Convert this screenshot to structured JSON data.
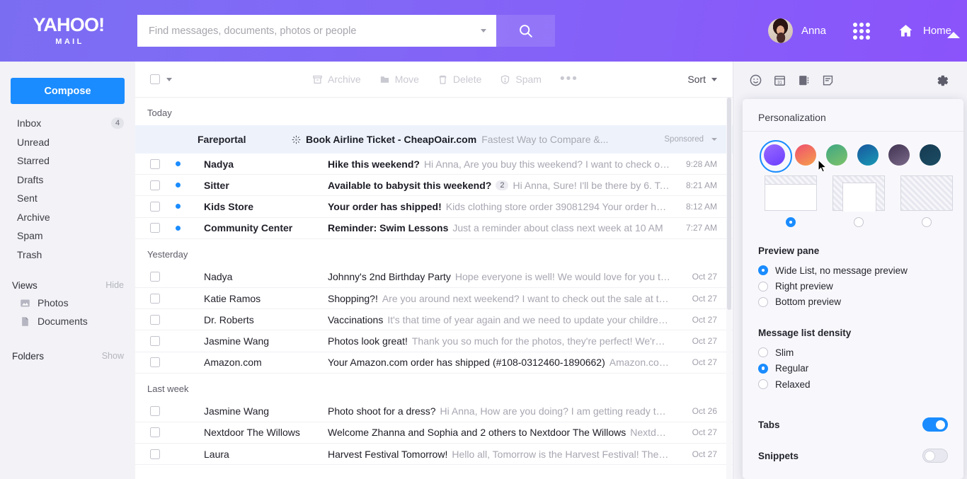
{
  "header": {
    "logo_main": "YAHOO!",
    "logo_sub": "MAIL",
    "search_placeholder": "Find messages, documents, photos or people",
    "search_value": "",
    "search_icon": "search-icon",
    "dropdown_icon": "chevron-down-icon",
    "user_name": "Anna",
    "apps_icon": "apps-grid-icon",
    "home_icon": "home-icon",
    "home_label": "Home",
    "gradient_from": "#7b6df2",
    "gradient_to": "#8b53fb"
  },
  "sidebar": {
    "compose_label": "Compose",
    "compose_color": "#1a8cff",
    "folders": [
      {
        "label": "Inbox",
        "count": "4"
      },
      {
        "label": "Unread",
        "count": ""
      },
      {
        "label": "Starred",
        "count": ""
      },
      {
        "label": "Drafts",
        "count": ""
      },
      {
        "label": "Sent",
        "count": ""
      },
      {
        "label": "Archive",
        "count": ""
      },
      {
        "label": "Spam",
        "count": ""
      },
      {
        "label": "Trash",
        "count": ""
      }
    ],
    "views_title": "Views",
    "views_toggle": "Hide",
    "views": [
      {
        "label": "Photos",
        "icon": "photo-icon"
      },
      {
        "label": "Documents",
        "icon": "document-icon"
      }
    ],
    "folders_title": "Folders",
    "folders_toggle": "Show"
  },
  "toolbar": {
    "select_all_icon": "checkbox-icon",
    "select_all_chevron": "chevron-down-icon",
    "archive_label": "Archive",
    "move_label": "Move",
    "delete_label": "Delete",
    "spam_label": "Spam",
    "more_label": "•••",
    "sort_label": "Sort"
  },
  "maillist": {
    "groups": [
      {
        "label": "Today",
        "ad": {
          "sender": "Fareportal",
          "title": "Book Airline Ticket - CheapOair.com",
          "description": "Fastest Way to Compare &...",
          "tag": "Sponsored",
          "icon": "sponsored-starburst-icon"
        },
        "rows": [
          {
            "sender": "Nadya",
            "unread": true,
            "subject": "Hike this weekend?",
            "snippet": "Hi Anna, Are you buy this weekend? I want to check out this",
            "time": "9:28 AM",
            "thread": ""
          },
          {
            "sender": "Sitter",
            "unread": true,
            "subject": "Available to babysit this weekend?",
            "snippet": "Hi Anna, Sure! I'll be there by 6. Take care, Sara",
            "time": "8:21 AM",
            "thread": "2"
          },
          {
            "sender": "Kids Store",
            "unread": true,
            "subject": "Your order has shipped!",
            "snippet": "Kids clothing store order 39081294 Your order has shipped and",
            "time": "8:12 AM",
            "thread": ""
          },
          {
            "sender": "Community Center",
            "unread": true,
            "subject": "Reminder: Swim Lessons",
            "snippet": "Just a reminder about class next week at 10 AM",
            "time": "7:27 AM",
            "thread": ""
          }
        ]
      },
      {
        "label": "Yesterday",
        "rows": [
          {
            "sender": "Nadya",
            "unread": false,
            "subject": "Johnny's 2nd Birthday Party",
            "snippet": "Hope everyone is well! We would love for you to join",
            "time": "Oct 27",
            "thread": ""
          },
          {
            "sender": "Katie Ramos",
            "unread": false,
            "subject": "Shopping?!",
            "snippet": "Are you around next weekend? I want to check out the sale at this new boutique",
            "time": "Oct 27",
            "thread": ""
          },
          {
            "sender": "Dr. Roberts",
            "unread": false,
            "subject": "Vaccinations",
            "snippet": "It's that time of year again and we need to update your children's vaccinations",
            "time": "Oct 27",
            "thread": ""
          },
          {
            "sender": "Jasmine Wang",
            "unread": false,
            "subject": "Photos look great!",
            "snippet": "Thank you so much for the photos, they're perfect! We're ready to launch",
            "time": "Oct 27",
            "thread": ""
          },
          {
            "sender": "Amazon.com",
            "unread": false,
            "subject": "Your Amazon.com order has shipped (#108-0312460-1890662)",
            "snippet": "Amazon.com Shipping",
            "time": "Oct 27",
            "thread": ""
          }
        ]
      },
      {
        "label": "Last week",
        "rows": [
          {
            "sender": "Jasmine Wang",
            "unread": false,
            "subject": "Photo shoot for a dress?",
            "snippet": "Hi Anna, How are you doing? I am getting ready to launch",
            "time": "Oct 26",
            "thread": ""
          },
          {
            "sender": "Nextdoor The Willows",
            "unread": false,
            "subject": "Welcome Zhanna and Sophia and 2 others to Nextdoor The Willows",
            "snippet": "Nextdoor Hi Ana,",
            "time": "Oct 27",
            "thread": ""
          },
          {
            "sender": "Laura",
            "unread": false,
            "subject": "Harvest Festival Tomorrow!",
            "snippet": "Hello all, Tomorrow is the Harvest Festival! The Harvest",
            "time": "Oct 27",
            "thread": ""
          }
        ]
      }
    ]
  },
  "rail": {
    "icons": [
      {
        "name": "smiley-icon"
      },
      {
        "name": "calendar-icon",
        "label": "31"
      },
      {
        "name": "contacts-icon"
      },
      {
        "name": "notepad-icon"
      }
    ],
    "gear_icon": "gear-icon"
  },
  "panel": {
    "title": "Personalization",
    "themes": [
      {
        "name": "theme-purple",
        "from": "#9a6bff",
        "to": "#6a3cff",
        "selected": true
      },
      {
        "name": "theme-sunset",
        "from": "#ef4e6e",
        "to": "#f5a04b",
        "selected": false
      },
      {
        "name": "theme-green",
        "from": "#3fa683",
        "to": "#7fc36a",
        "selected": false
      },
      {
        "name": "theme-ocean",
        "from": "#17569e",
        "to": "#1a9ab5",
        "selected": false
      },
      {
        "name": "theme-plum",
        "from": "#413251",
        "to": "#7b6a89",
        "selected": false
      },
      {
        "name": "theme-navy",
        "from": "#153a52",
        "to": "#1c4d63",
        "selected": false
      }
    ],
    "layouts": [
      {
        "name": "layout-top-band",
        "selected": true
      },
      {
        "name": "layout-center-frame",
        "selected": false
      },
      {
        "name": "layout-full-pattern",
        "selected": false
      }
    ],
    "preview_pane": {
      "title": "Preview pane",
      "options": [
        {
          "label": "Wide List, no message preview",
          "selected": true
        },
        {
          "label": "Right preview",
          "selected": false
        },
        {
          "label": "Bottom preview",
          "selected": false
        }
      ]
    },
    "density": {
      "title": "Message list density",
      "options": [
        {
          "label": "Slim",
          "selected": false
        },
        {
          "label": "Regular",
          "selected": true
        },
        {
          "label": "Relaxed",
          "selected": false
        }
      ]
    },
    "toggles": [
      {
        "label": "Tabs",
        "on": true
      },
      {
        "label": "Snippets",
        "on": false
      }
    ],
    "accent_color": "#1a8cff"
  }
}
